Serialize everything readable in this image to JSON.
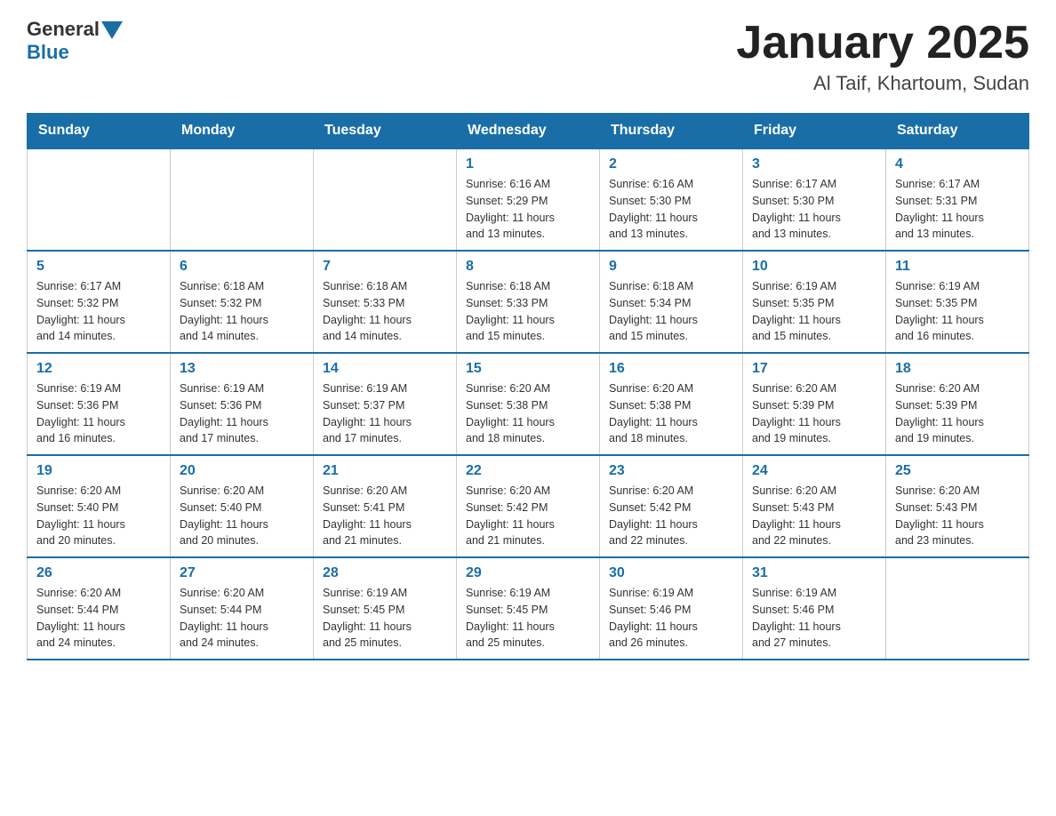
{
  "header": {
    "logo_general": "General",
    "logo_blue": "Blue",
    "month_title": "January 2025",
    "location": "Al Taif, Khartoum, Sudan"
  },
  "weekdays": [
    "Sunday",
    "Monday",
    "Tuesday",
    "Wednesday",
    "Thursday",
    "Friday",
    "Saturday"
  ],
  "weeks": [
    [
      {
        "day": "",
        "info": ""
      },
      {
        "day": "",
        "info": ""
      },
      {
        "day": "",
        "info": ""
      },
      {
        "day": "1",
        "info": "Sunrise: 6:16 AM\nSunset: 5:29 PM\nDaylight: 11 hours\nand 13 minutes."
      },
      {
        "day": "2",
        "info": "Sunrise: 6:16 AM\nSunset: 5:30 PM\nDaylight: 11 hours\nand 13 minutes."
      },
      {
        "day": "3",
        "info": "Sunrise: 6:17 AM\nSunset: 5:30 PM\nDaylight: 11 hours\nand 13 minutes."
      },
      {
        "day": "4",
        "info": "Sunrise: 6:17 AM\nSunset: 5:31 PM\nDaylight: 11 hours\nand 13 minutes."
      }
    ],
    [
      {
        "day": "5",
        "info": "Sunrise: 6:17 AM\nSunset: 5:32 PM\nDaylight: 11 hours\nand 14 minutes."
      },
      {
        "day": "6",
        "info": "Sunrise: 6:18 AM\nSunset: 5:32 PM\nDaylight: 11 hours\nand 14 minutes."
      },
      {
        "day": "7",
        "info": "Sunrise: 6:18 AM\nSunset: 5:33 PM\nDaylight: 11 hours\nand 14 minutes."
      },
      {
        "day": "8",
        "info": "Sunrise: 6:18 AM\nSunset: 5:33 PM\nDaylight: 11 hours\nand 15 minutes."
      },
      {
        "day": "9",
        "info": "Sunrise: 6:18 AM\nSunset: 5:34 PM\nDaylight: 11 hours\nand 15 minutes."
      },
      {
        "day": "10",
        "info": "Sunrise: 6:19 AM\nSunset: 5:35 PM\nDaylight: 11 hours\nand 15 minutes."
      },
      {
        "day": "11",
        "info": "Sunrise: 6:19 AM\nSunset: 5:35 PM\nDaylight: 11 hours\nand 16 minutes."
      }
    ],
    [
      {
        "day": "12",
        "info": "Sunrise: 6:19 AM\nSunset: 5:36 PM\nDaylight: 11 hours\nand 16 minutes."
      },
      {
        "day": "13",
        "info": "Sunrise: 6:19 AM\nSunset: 5:36 PM\nDaylight: 11 hours\nand 17 minutes."
      },
      {
        "day": "14",
        "info": "Sunrise: 6:19 AM\nSunset: 5:37 PM\nDaylight: 11 hours\nand 17 minutes."
      },
      {
        "day": "15",
        "info": "Sunrise: 6:20 AM\nSunset: 5:38 PM\nDaylight: 11 hours\nand 18 minutes."
      },
      {
        "day": "16",
        "info": "Sunrise: 6:20 AM\nSunset: 5:38 PM\nDaylight: 11 hours\nand 18 minutes."
      },
      {
        "day": "17",
        "info": "Sunrise: 6:20 AM\nSunset: 5:39 PM\nDaylight: 11 hours\nand 19 minutes."
      },
      {
        "day": "18",
        "info": "Sunrise: 6:20 AM\nSunset: 5:39 PM\nDaylight: 11 hours\nand 19 minutes."
      }
    ],
    [
      {
        "day": "19",
        "info": "Sunrise: 6:20 AM\nSunset: 5:40 PM\nDaylight: 11 hours\nand 20 minutes."
      },
      {
        "day": "20",
        "info": "Sunrise: 6:20 AM\nSunset: 5:40 PM\nDaylight: 11 hours\nand 20 minutes."
      },
      {
        "day": "21",
        "info": "Sunrise: 6:20 AM\nSunset: 5:41 PM\nDaylight: 11 hours\nand 21 minutes."
      },
      {
        "day": "22",
        "info": "Sunrise: 6:20 AM\nSunset: 5:42 PM\nDaylight: 11 hours\nand 21 minutes."
      },
      {
        "day": "23",
        "info": "Sunrise: 6:20 AM\nSunset: 5:42 PM\nDaylight: 11 hours\nand 22 minutes."
      },
      {
        "day": "24",
        "info": "Sunrise: 6:20 AM\nSunset: 5:43 PM\nDaylight: 11 hours\nand 22 minutes."
      },
      {
        "day": "25",
        "info": "Sunrise: 6:20 AM\nSunset: 5:43 PM\nDaylight: 11 hours\nand 23 minutes."
      }
    ],
    [
      {
        "day": "26",
        "info": "Sunrise: 6:20 AM\nSunset: 5:44 PM\nDaylight: 11 hours\nand 24 minutes."
      },
      {
        "day": "27",
        "info": "Sunrise: 6:20 AM\nSunset: 5:44 PM\nDaylight: 11 hours\nand 24 minutes."
      },
      {
        "day": "28",
        "info": "Sunrise: 6:19 AM\nSunset: 5:45 PM\nDaylight: 11 hours\nand 25 minutes."
      },
      {
        "day": "29",
        "info": "Sunrise: 6:19 AM\nSunset: 5:45 PM\nDaylight: 11 hours\nand 25 minutes."
      },
      {
        "day": "30",
        "info": "Sunrise: 6:19 AM\nSunset: 5:46 PM\nDaylight: 11 hours\nand 26 minutes."
      },
      {
        "day": "31",
        "info": "Sunrise: 6:19 AM\nSunset: 5:46 PM\nDaylight: 11 hours\nand 27 minutes."
      },
      {
        "day": "",
        "info": ""
      }
    ]
  ]
}
